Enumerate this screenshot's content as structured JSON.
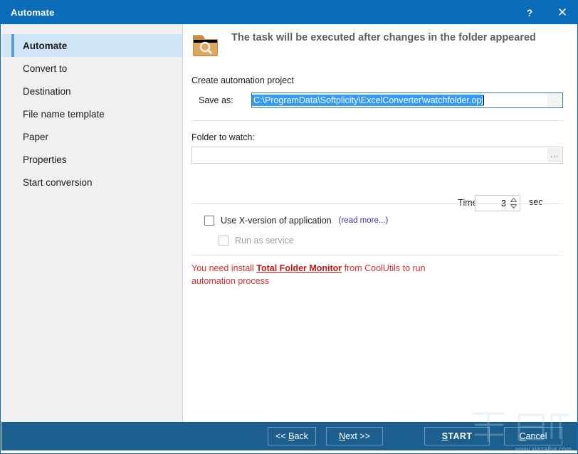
{
  "window": {
    "title": "Automate",
    "help_icon": "question-mark-icon",
    "close_icon": "close-icon"
  },
  "sidebar": {
    "items": [
      {
        "label": "Automate",
        "selected": true
      },
      {
        "label": "Convert to",
        "selected": false
      },
      {
        "label": "Destination",
        "selected": false
      },
      {
        "label": "File name template",
        "selected": false
      },
      {
        "label": "Paper",
        "selected": false
      },
      {
        "label": "Properties",
        "selected": false
      },
      {
        "label": "Start conversion",
        "selected": false
      }
    ]
  },
  "content": {
    "header_icon": "folder-search-icon",
    "header_title": "The task will be executed after changes in the folder appeared",
    "create_project_label": "Create automation project",
    "save_as_label": "Save as:",
    "save_as_value": "C:\\ProgramData\\Softplicity\\ExcelConverter\\watchfolder.opj",
    "save_as_browse_label": "...",
    "folder_to_watch_label": "Folder to watch:",
    "folder_to_watch_value": "",
    "folder_to_watch_browse_label": "...",
    "timeout_label": "Timeout",
    "timeout_value": "3",
    "timeout_units": "sec",
    "xversion_checkbox_label": "Use X-version of application",
    "xversion_checked": false,
    "read_more_label": "(read more...)",
    "run_as_service_label": "Run as service",
    "run_as_service_checked": false,
    "run_as_service_disabled": true,
    "warning_prefix": "You need install ",
    "warning_link": "Total Folder Monitor",
    "warning_suffix": " from CoolUtils to run automation process"
  },
  "footer": {
    "back_label": "<< Back",
    "back_accel": "B",
    "next_label": "Next >>",
    "next_accel": "N",
    "start_label": "START",
    "start_accel": "S",
    "cancel_label": "Cancel",
    "cancel_accel": "C"
  },
  "watermark": {
    "url": "www.xiazaiba.com"
  },
  "colors": {
    "titlebar": "#0a6cb8",
    "footer": "#1c5f8e",
    "sidebar_bg": "#f0eff1",
    "sidebar_selected": "#cfe5f7",
    "sidebar_accent": "#5d9fd8",
    "selection_blue": "#3399ff",
    "warning_red": "#d42e2e",
    "link_blue": "#36368f"
  }
}
